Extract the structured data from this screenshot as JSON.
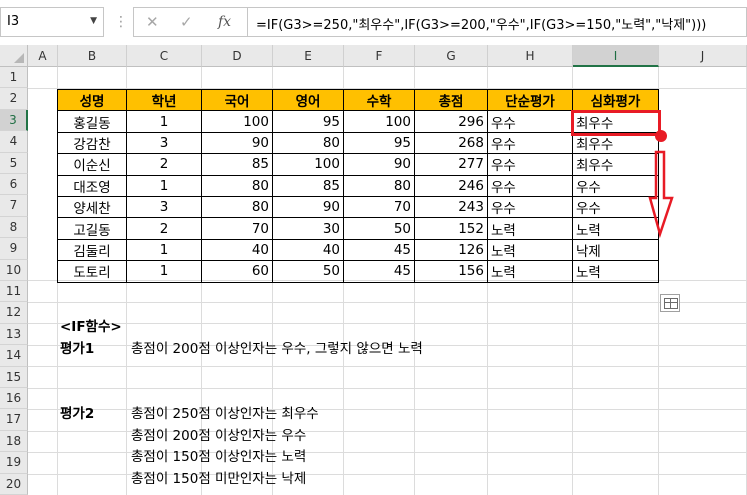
{
  "formula_bar": {
    "name_box": "I3",
    "formula": "=IF(G3>=250,\"최우수\",IF(G3>=200,\"우수\",IF(G3>=150,\"노력\",\"낙제\")))",
    "cancel_glyph": "✕",
    "enter_glyph": "✓",
    "fx_label": "fx"
  },
  "columns": [
    "A",
    "B",
    "C",
    "D",
    "E",
    "F",
    "G",
    "H",
    "I",
    "J"
  ],
  "rows": [
    "1",
    "2",
    "3",
    "4",
    "5",
    "6",
    "7",
    "8",
    "9",
    "10",
    "11",
    "12",
    "13",
    "14",
    "15",
    "16",
    "17",
    "18",
    "19",
    "20"
  ],
  "selected_cell": "I3",
  "table": {
    "headers": [
      "성명",
      "학년",
      "국어",
      "영어",
      "수학",
      "총점",
      "단순평가",
      "심화평가"
    ],
    "rows": [
      [
        "홍길동",
        "1",
        "100",
        "95",
        "100",
        "296",
        "우수",
        "최우수"
      ],
      [
        "강감찬",
        "3",
        "90",
        "80",
        "95",
        "268",
        "우수",
        "최우수"
      ],
      [
        "이순신",
        "2",
        "85",
        "100",
        "90",
        "277",
        "우수",
        "최우수"
      ],
      [
        "대조영",
        "1",
        "80",
        "85",
        "80",
        "246",
        "우수",
        "우수"
      ],
      [
        "양세찬",
        "3",
        "80",
        "90",
        "70",
        "243",
        "우수",
        "우수"
      ],
      [
        "고길동",
        "2",
        "70",
        "30",
        "50",
        "152",
        "노력",
        "노력"
      ],
      [
        "김둘리",
        "1",
        "40",
        "40",
        "45",
        "126",
        "노력",
        "낙제"
      ],
      [
        "도토리",
        "1",
        "60",
        "50",
        "45",
        "156",
        "노력",
        "노력"
      ]
    ]
  },
  "notes": {
    "title": "<IF함수>",
    "eval1_label": "평가1",
    "eval1_text": "총점이 200점 이상인자는 우수, 그렇지 않으면 노력",
    "eval2_label": "평가2",
    "eval2_lines": [
      "총점이 250점 이상인자는 최우수",
      "총점이 200점 이상인자는 우수",
      "총점이 150점 이상인자는 노력",
      "총점이 150점 미만인자는 낙제"
    ]
  },
  "colors": {
    "header_fill": "#ffc000",
    "highlight": "#e81b25",
    "selection": "#217346"
  }
}
